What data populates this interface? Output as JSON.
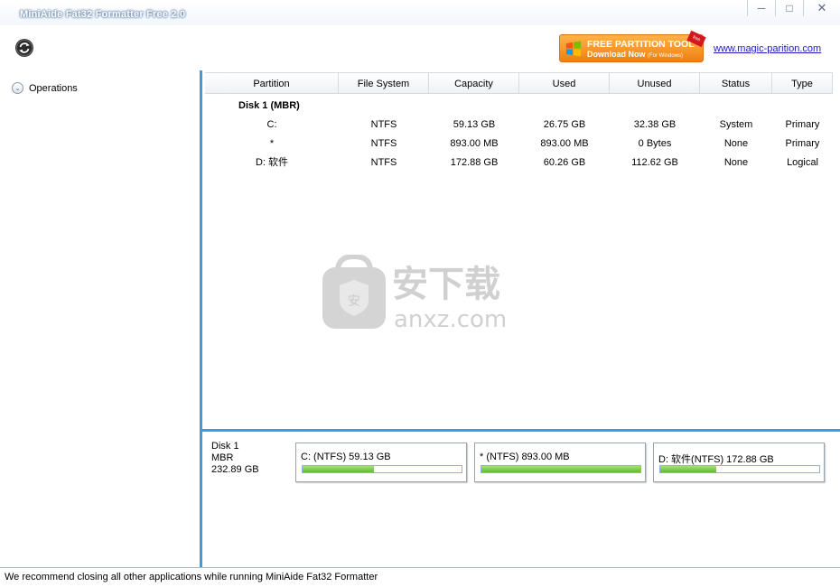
{
  "window": {
    "title": "MiniAide Fat32 Formatter Free 2.0",
    "minimize": "─",
    "maximize": "□",
    "close": "✕"
  },
  "toolbar": {
    "refresh_icon": "refresh-icon",
    "promo_line1": "FREE PARTITION TOOL",
    "promo_line2": "Download Now",
    "promo_line2_small": "(For Windows)",
    "promo_badge": "free",
    "link_text": "www.magic-parition.com"
  },
  "sidebar": {
    "operations_label": "Operations",
    "chevron": "⌄"
  },
  "table": {
    "columns": [
      "Partition",
      "File System",
      "Capacity",
      "Used",
      "Unused",
      "Status",
      "Type"
    ],
    "disk_label": "Disk 1 (MBR)",
    "rows": [
      [
        "C:",
        "NTFS",
        "59.13 GB",
        "26.75 GB",
        "32.38 GB",
        "System",
        "Primary"
      ],
      [
        "*",
        "NTFS",
        "893.00 MB",
        "893.00 MB",
        "0 Bytes",
        "None",
        "Primary"
      ],
      [
        "D: 软件",
        "NTFS",
        "172.88 GB",
        "60.26 GB",
        "112.62 GB",
        "None",
        "Logical"
      ]
    ]
  },
  "diskmap": {
    "disk_name": "Disk 1",
    "disk_type": "MBR",
    "disk_size": "232.89 GB",
    "partitions": [
      {
        "label": "C: (NTFS) 59.13 GB",
        "used_fraction": 0.45
      },
      {
        "label": "* (NTFS) 893.00 MB",
        "used_fraction": 1.0
      },
      {
        "label": "D: 软件(NTFS) 172.88 GB",
        "used_fraction": 0.35
      }
    ]
  },
  "watermark": {
    "text_cn": "安下载",
    "text_en": "anxz.com"
  },
  "status_bar": {
    "message": "We recommend closing all other applications while running MiniAide Fat32 Formatter"
  },
  "colors": {
    "accent": "#3f9be0",
    "used_bar": "#5fbd2e",
    "promo": "#f07f10"
  }
}
